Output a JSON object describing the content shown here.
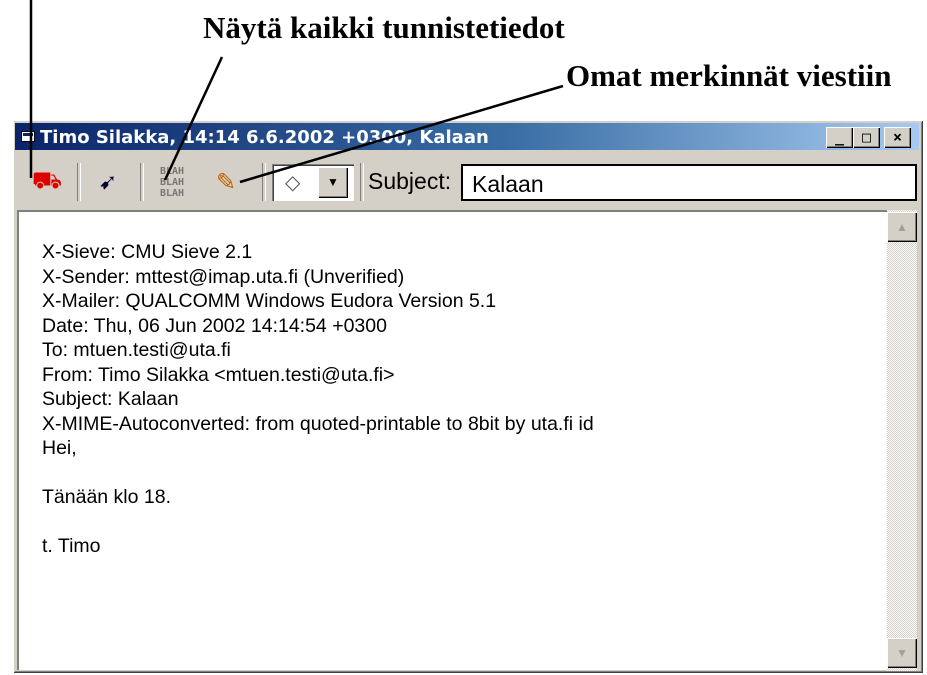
{
  "annotations": {
    "show_headers": "Näytä kaikki tunnistetiedot",
    "own_notes": "Omat merkinnät viestiin"
  },
  "window": {
    "title": "Timo Silakka, 14:14 6.6.2002 +0300, Kalaan",
    "controls": {
      "minimize": "_",
      "maximize": "□",
      "close": "×"
    }
  },
  "toolbar": {
    "icons": [
      "delete-icon",
      "tool-icon",
      "blah-icon",
      "pencil-icon"
    ],
    "blah_lines": [
      "BLAH",
      "BLAH",
      "BLAH"
    ],
    "label_value": "◇",
    "subject_label": "Subject:",
    "subject_value": "Kalaan"
  },
  "message": {
    "headers": [
      "X-Sieve: CMU Sieve 2.1",
      "X-Sender: mttest@imap.uta.fi (Unverified)",
      "X-Mailer: QUALCOMM Windows Eudora Version 5.1",
      "Date: Thu, 06 Jun 2002 14:14:54 +0300",
      "To: mtuen.testi@uta.fi",
      "From: Timo Silakka <mtuen.testi@uta.fi>",
      "Subject: Kalaan",
      "X-MIME-Autoconverted: from quoted-printable to 8bit by uta.fi id"
    ],
    "body": [
      "Hei,",
      "Tänään klo 18.",
      "t. Timo"
    ]
  }
}
